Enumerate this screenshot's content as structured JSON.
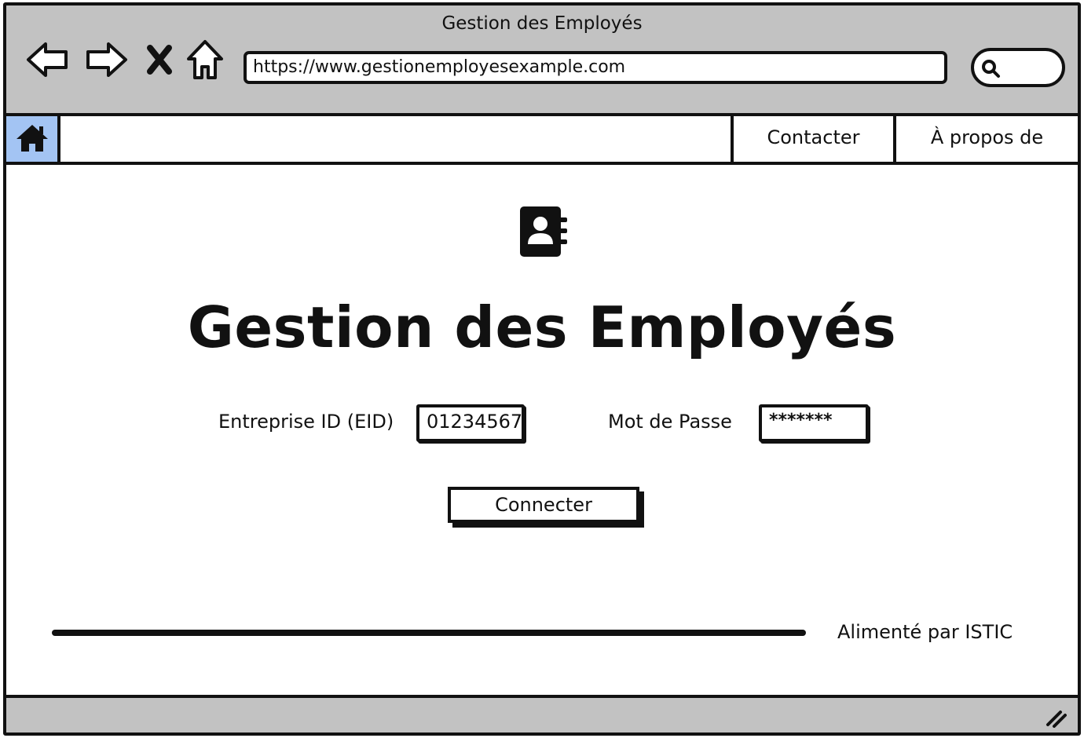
{
  "window": {
    "title": "Gestion des Employés"
  },
  "browser": {
    "url": "https://www.gestionemployesexample.com",
    "back_icon": "arrow-left-icon",
    "forward_icon": "arrow-right-icon",
    "close_icon": "close-x-icon",
    "home_icon": "home-outline-icon",
    "search_icon": "search-icon"
  },
  "nav": {
    "home_icon": "home-icon",
    "home_color": "#a3c4f3",
    "items": [
      {
        "label": "Contacter"
      },
      {
        "label": "À propos de"
      }
    ]
  },
  "main": {
    "logo_icon": "address-book-icon",
    "title": "Gestion des Employés",
    "eid": {
      "label": "Entreprise ID (EID)",
      "value": "01234567"
    },
    "password": {
      "label": "Mot de Passe",
      "value": "*******"
    },
    "connect_label": "Connecter"
  },
  "footer": {
    "text": "Alimenté par ISTIC"
  },
  "colors": {
    "chrome": "#c2c2c2",
    "accent": "#a3c4f3",
    "ink": "#111111"
  }
}
